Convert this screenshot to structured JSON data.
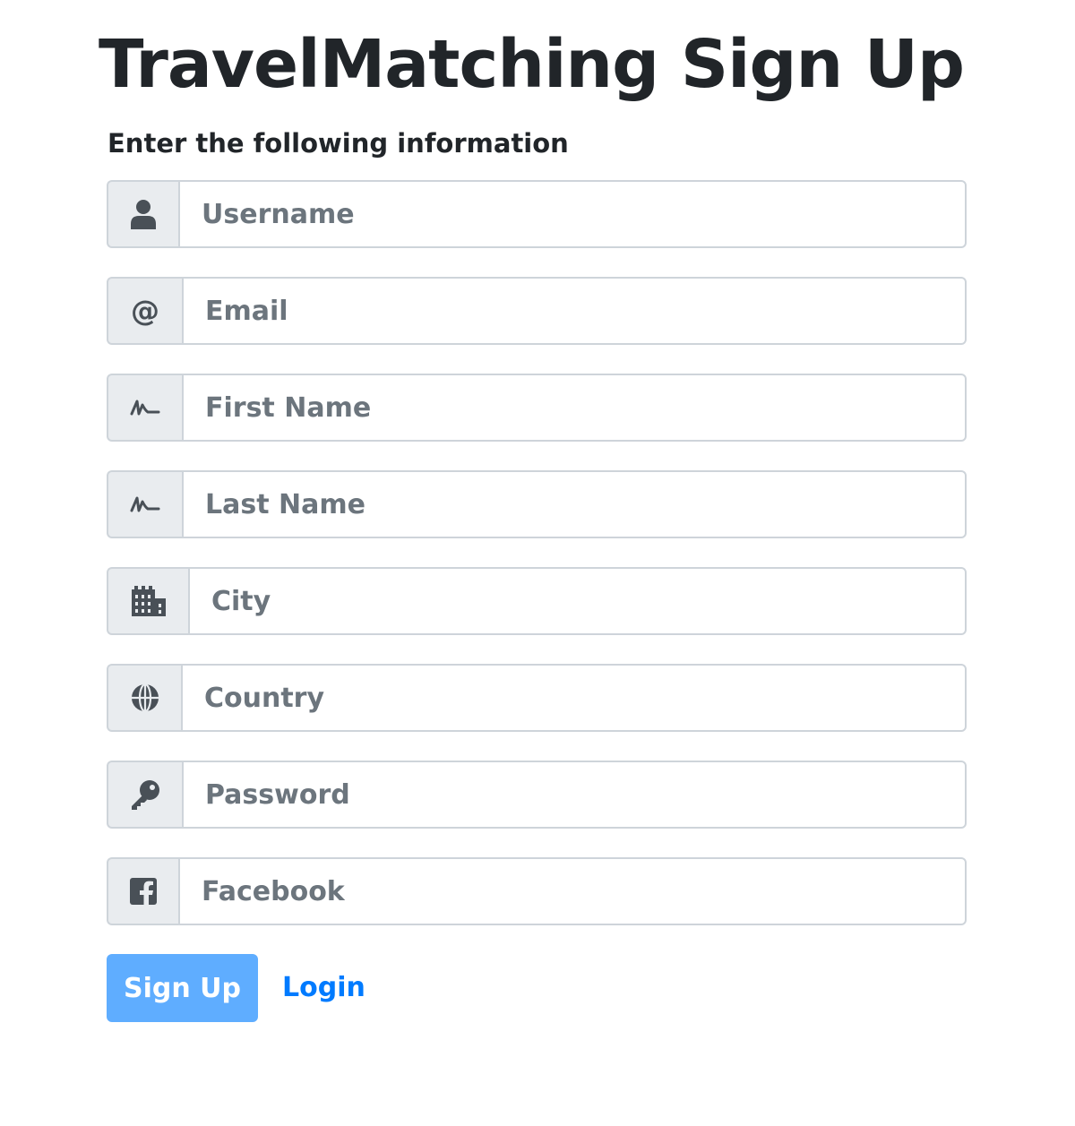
{
  "page": {
    "title": "TravelMatching Sign Up",
    "subtitle": "Enter the following information"
  },
  "form": {
    "fields": [
      {
        "icon": "user-icon",
        "placeholder": "Username",
        "value": ""
      },
      {
        "icon": "at-icon",
        "placeholder": "Email",
        "value": ""
      },
      {
        "icon": "signature-icon",
        "placeholder": "First Name",
        "value": ""
      },
      {
        "icon": "signature-icon",
        "placeholder": "Last Name",
        "value": ""
      },
      {
        "icon": "city-icon",
        "placeholder": "City",
        "value": ""
      },
      {
        "icon": "globe-icon",
        "placeholder": "Country",
        "value": ""
      },
      {
        "icon": "key-icon",
        "placeholder": "Password",
        "value": ""
      },
      {
        "icon": "facebook-icon",
        "placeholder": "Facebook",
        "value": ""
      }
    ],
    "signup_label": "Sign Up",
    "login_label": "Login"
  },
  "colors": {
    "text": "#212529",
    "placeholder": "#6c757d",
    "addon_bg": "#e9ecef",
    "border": "#ced4da",
    "button_bg": "#5fadff",
    "link": "#007bff"
  }
}
